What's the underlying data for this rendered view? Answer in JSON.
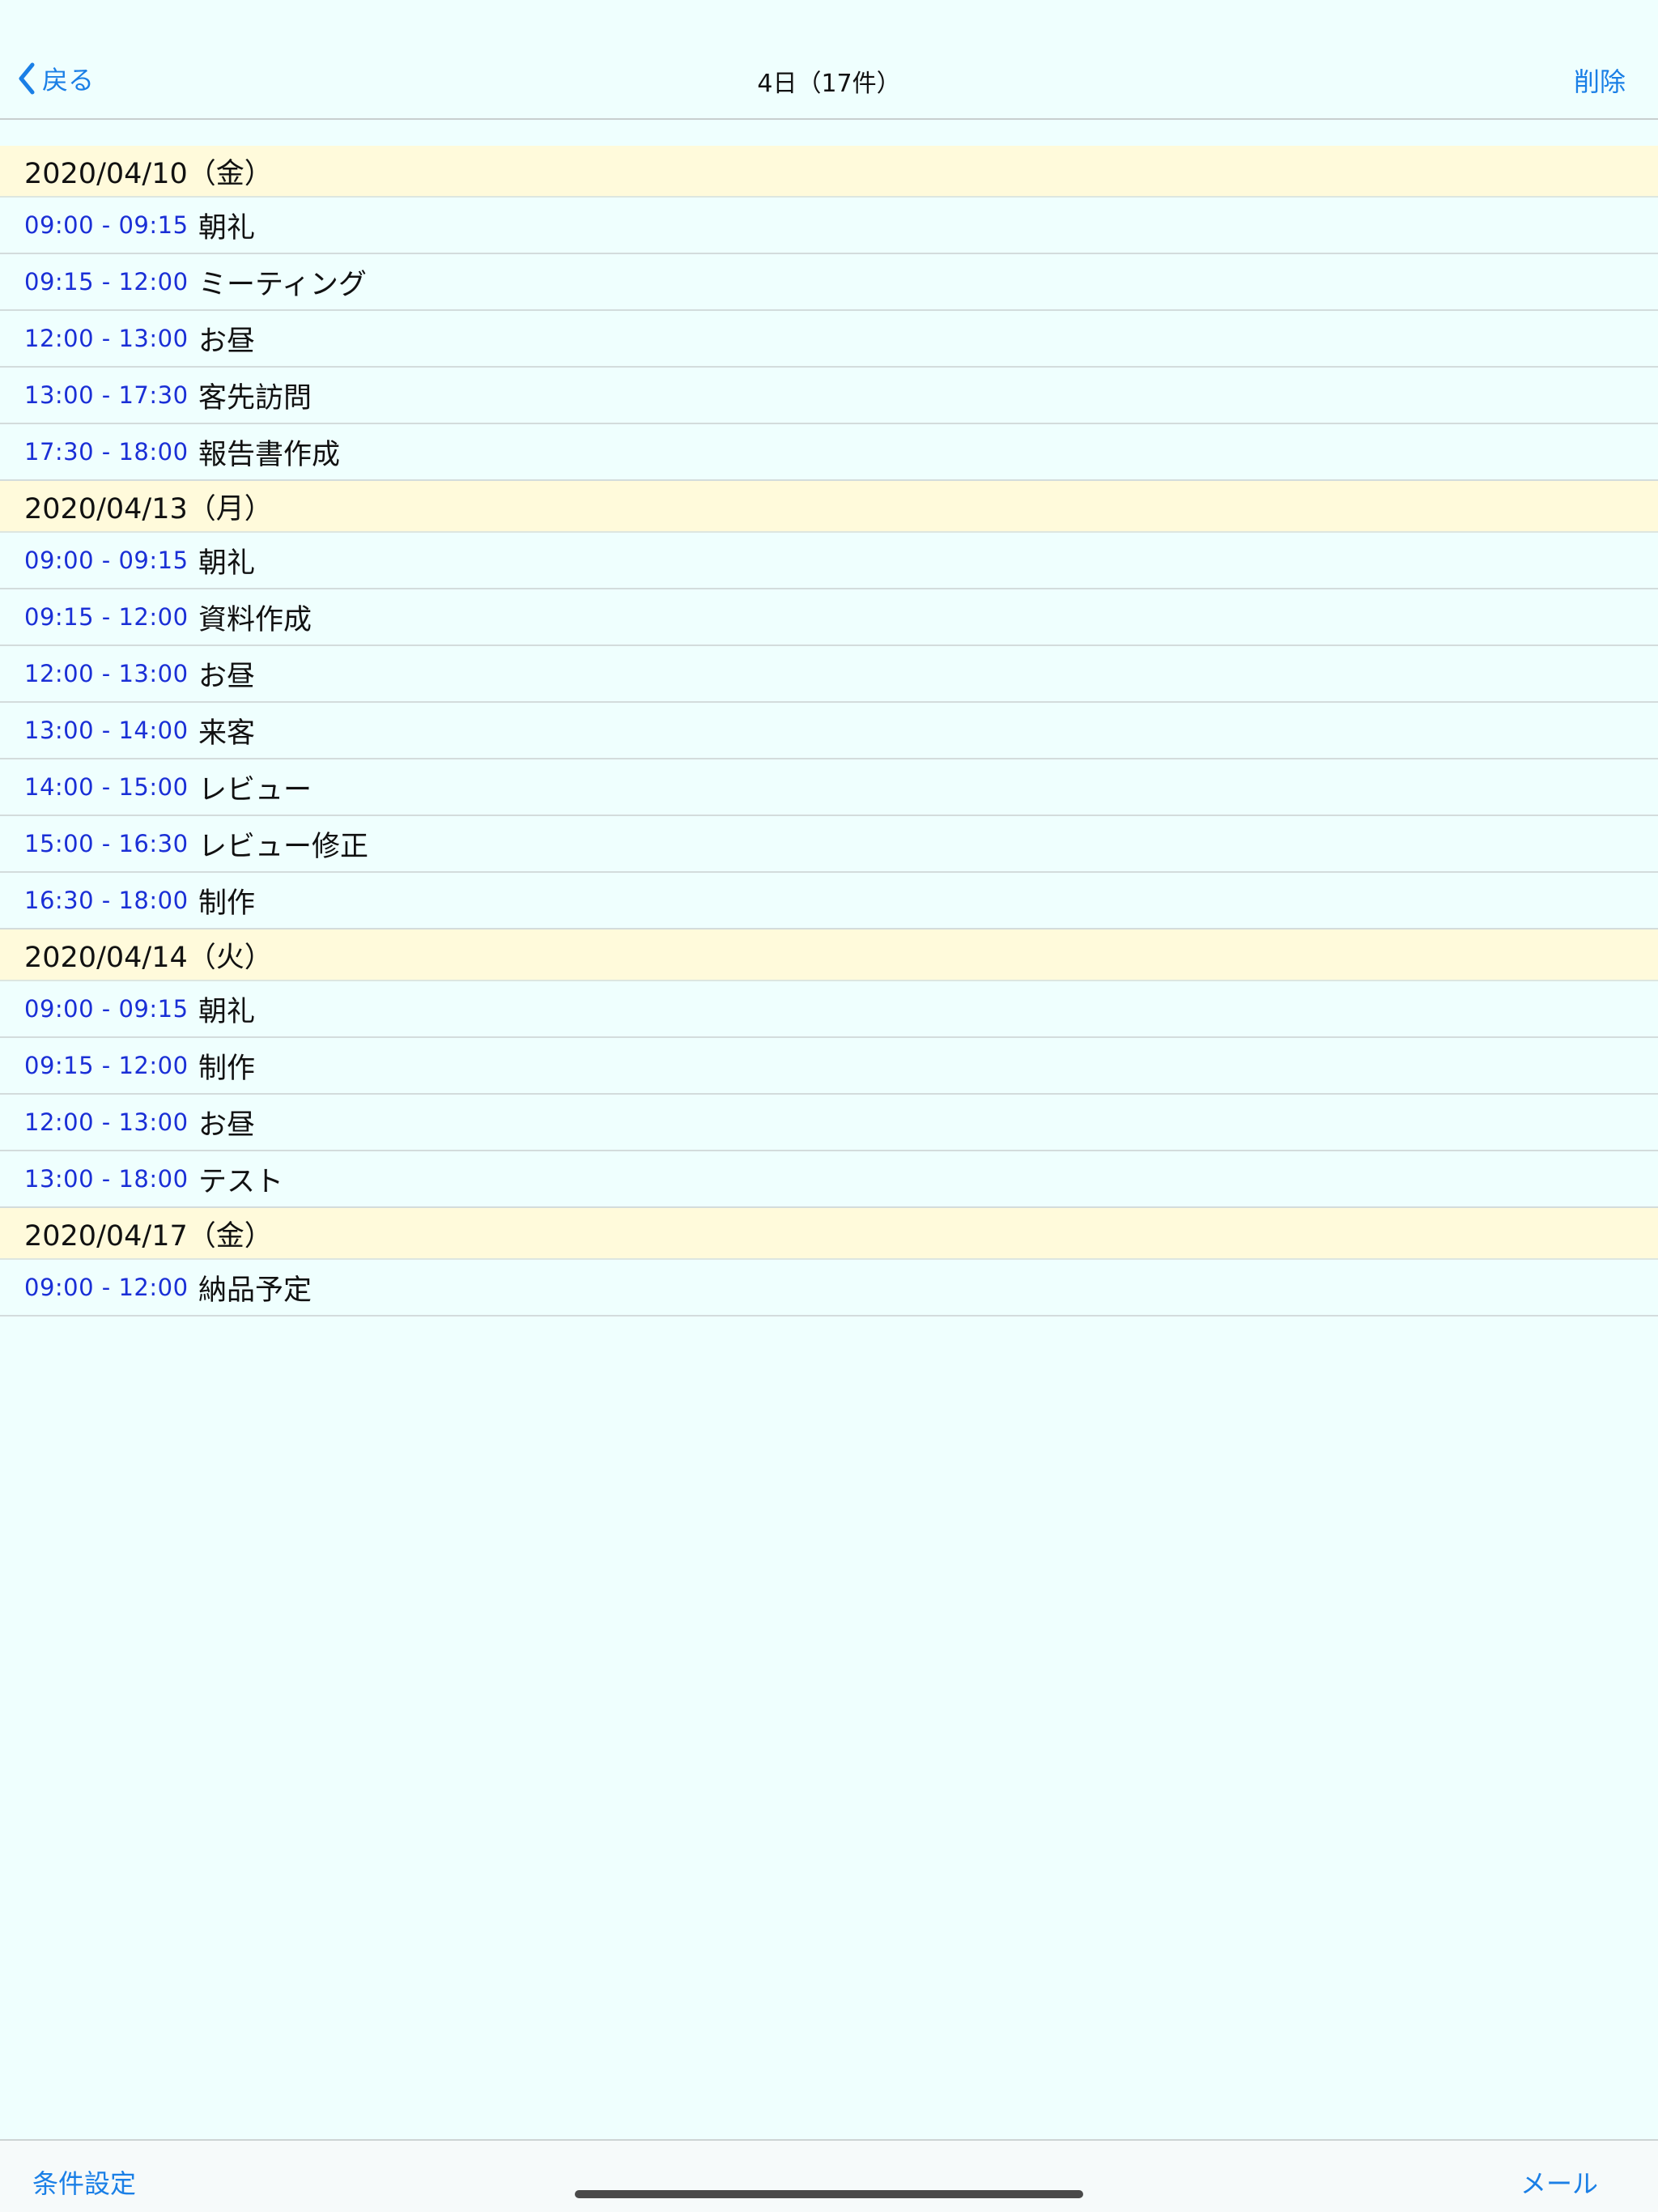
{
  "navbar": {
    "back_label": "戻る",
    "title": "4日（17件）",
    "delete_label": "削除"
  },
  "sections": [
    {
      "date": "2020/04/10（金）",
      "items": [
        {
          "time": "09:00 - 09:15",
          "title": "朝礼"
        },
        {
          "time": "09:15 - 12:00",
          "title": "ミーティング"
        },
        {
          "time": "12:00 - 13:00",
          "title": "お昼"
        },
        {
          "time": "13:00 - 17:30",
          "title": "客先訪問"
        },
        {
          "time": "17:30 - 18:00",
          "title": "報告書作成"
        }
      ]
    },
    {
      "date": "2020/04/13（月）",
      "items": [
        {
          "time": "09:00 - 09:15",
          "title": "朝礼"
        },
        {
          "time": "09:15 - 12:00",
          "title": "資料作成"
        },
        {
          "time": "12:00 - 13:00",
          "title": "お昼"
        },
        {
          "time": "13:00 - 14:00",
          "title": "来客"
        },
        {
          "time": "14:00 - 15:00",
          "title": "レビュー"
        },
        {
          "time": "15:00 - 16:30",
          "title": "レビュー修正"
        },
        {
          "time": "16:30 - 18:00",
          "title": "制作"
        }
      ]
    },
    {
      "date": "2020/04/14（火）",
      "items": [
        {
          "time": "09:00 - 09:15",
          "title": "朝礼"
        },
        {
          "time": "09:15 - 12:00",
          "title": "制作"
        },
        {
          "time": "12:00 - 13:00",
          "title": "お昼"
        },
        {
          "time": "13:00 - 18:00",
          "title": "テスト"
        }
      ]
    },
    {
      "date": "2020/04/17（金）",
      "items": [
        {
          "time": "09:00 - 12:00",
          "title": "納品予定"
        }
      ]
    }
  ],
  "toolbar": {
    "conditions_label": "条件設定",
    "mail_label": "メール"
  },
  "colors": {
    "background": "#effffe",
    "section_header": "#fffadb",
    "accent": "#1a7fe6",
    "time_text": "#1a2fd6"
  },
  "icons": {
    "back": "chevron-left-icon"
  }
}
